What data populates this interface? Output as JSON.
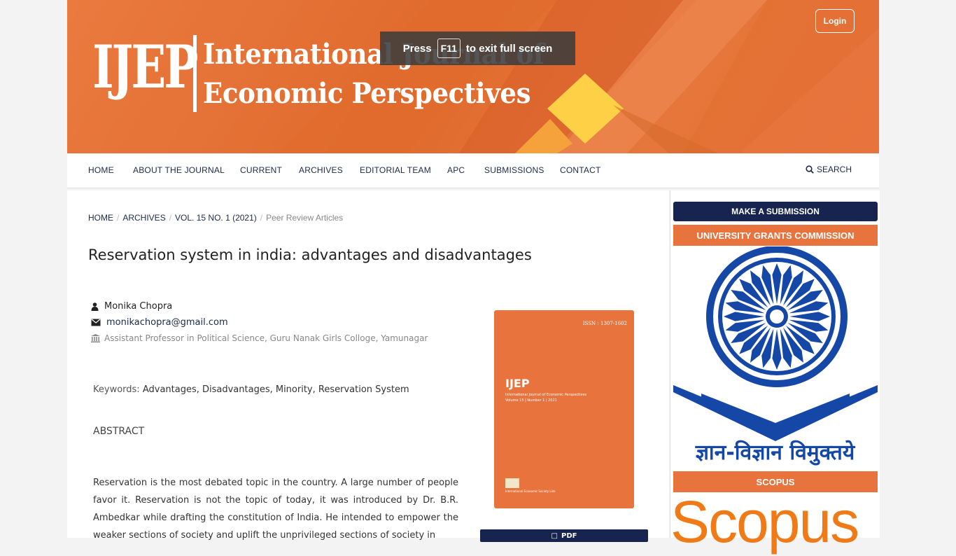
{
  "header": {
    "logo_abbr": "IJEP",
    "logo_title_line1": "International Journal of",
    "logo_title_line2": "Economic Perspectives",
    "login_label": "Login"
  },
  "fullscreen_toast": {
    "prefix": "Press",
    "key": "F11",
    "suffix": "to exit full screen"
  },
  "nav": {
    "items": [
      "HOME",
      "ABOUT THE JOURNAL",
      "CURRENT",
      "ARCHIVES",
      "EDITORIAL TEAM",
      "APC",
      "SUBMISSIONS",
      "CONTACT"
    ],
    "search_label": "SEARCH"
  },
  "breadcrumb": {
    "items": [
      "HOME",
      "ARCHIVES",
      "VOL. 15 NO. 1 (2021)"
    ],
    "current": "Peer Review Articles"
  },
  "article": {
    "title": "Reservation system in india: advantages and disadvantages",
    "author": "Monika Chopra",
    "email": "monikachopra@gmail.com",
    "affiliation": "Assistant Professor in Political Science, Guru Nanak Girls Colloge, Yamunagar",
    "keywords_label": "Keywords:",
    "keywords": "Advantages, Disadvantages, Minority, Reservation System",
    "abstract_heading": "ABSTRACT",
    "abstract_text": "Reservation is the most debated topic in the country. A large number of people favor it. Reservation is not the topic of today, it was introduced by Dr. B.R. Ambedkar while drafting the constitution of India. He intended to empower the weaker sections of society and uplift the unprivileged sections of society in"
  },
  "cover": {
    "issn": "ISSN : 1307-1602",
    "title": "IJEP",
    "subtitle": "International Journal of Economic Perspectives",
    "volume": "Volume 15 | Number 1 | 2021",
    "footer": "International Economic Society Link"
  },
  "pdf_button_label": "PDF",
  "sidebar": {
    "make_submission": "MAKE A SUBMISSION",
    "ugc_heading": "UNIVERSITY GRANTS COMMISSION",
    "ugc_motto": "ज्ञान-विज्ञान विमुक्तये",
    "scopus_heading": "SCOPUS",
    "scopus_logo": "Scopus"
  },
  "colors": {
    "brand_orange": "#e8733c",
    "navy": "#16244f",
    "ugc_blue": "#1447a6",
    "scopus_orange": "#f07b16"
  }
}
